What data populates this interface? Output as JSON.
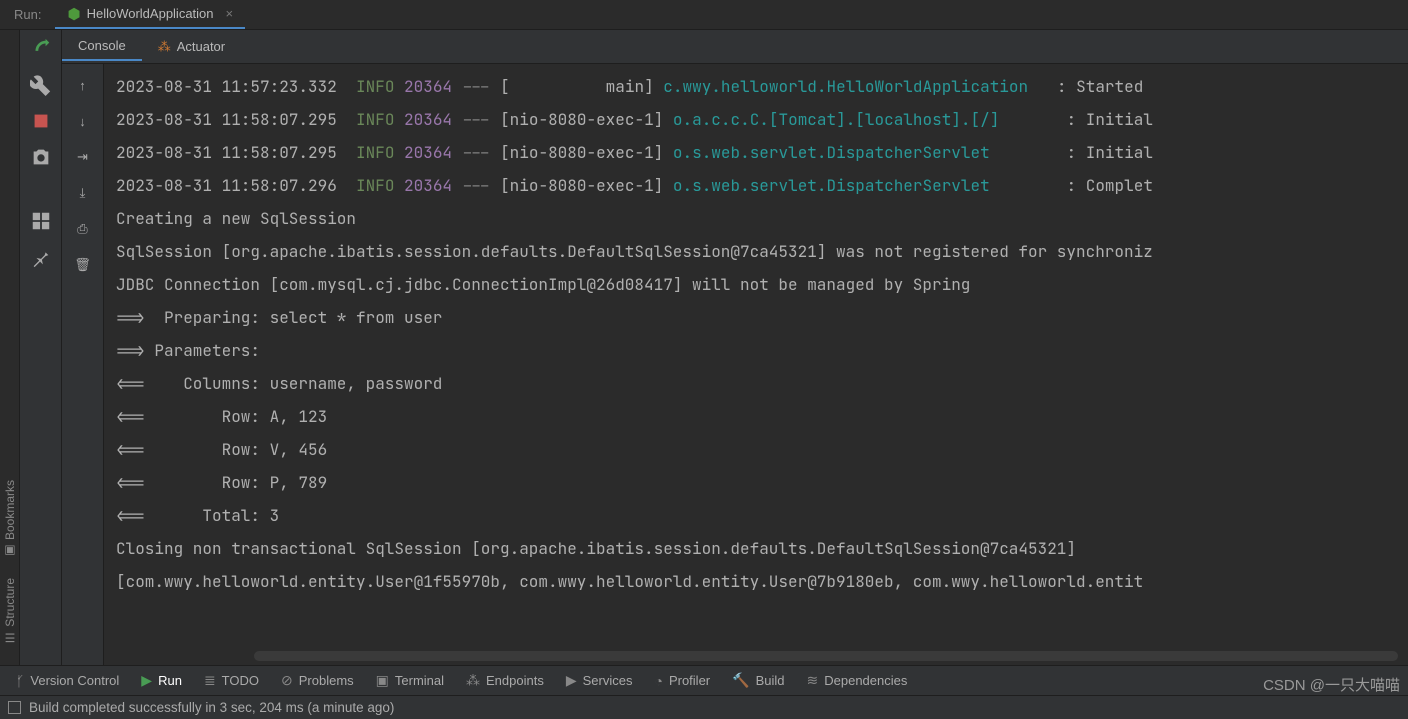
{
  "header": {
    "run_label": "Run:",
    "config_name": "HelloWorldApplication"
  },
  "panel_tabs": {
    "console": "Console",
    "actuator": "Actuator"
  },
  "log_lines": [
    {
      "ts": "2023-08-31 11:57:23.332",
      "lvl": "INFO",
      "pid": "20364",
      "thread": "[          main]",
      "class": "c.wwy.helloworld.HelloWorldApplication  ",
      "msg": ": Started"
    },
    {
      "ts": "2023-08-31 11:58:07.295",
      "lvl": "INFO",
      "pid": "20364",
      "thread": "[nio-8080-exec-1]",
      "class": "o.a.c.c.C.[Tomcat].[localhost].[/]      ",
      "msg": ": Initial"
    },
    {
      "ts": "2023-08-31 11:58:07.295",
      "lvl": "INFO",
      "pid": "20364",
      "thread": "[nio-8080-exec-1]",
      "class": "o.s.web.servlet.DispatcherServlet       ",
      "msg": ": Initial"
    },
    {
      "ts": "2023-08-31 11:58:07.296",
      "lvl": "INFO",
      "pid": "20364",
      "thread": "[nio-8080-exec-1]",
      "class": "o.s.web.servlet.DispatcherServlet       ",
      "msg": ": Complet"
    }
  ],
  "plain_lines": [
    "Creating a new SqlSession",
    "SqlSession [org.apache.ibatis.session.defaults.DefaultSqlSession@7ca45321] was not registered for synchroniz",
    "JDBC Connection [com.mysql.cj.jdbc.ConnectionImpl@26d08417] will not be managed by Spring",
    "==>  Preparing: select * from user",
    "==> Parameters: ",
    "<==    Columns: username, password",
    "<==        Row: A, 123",
    "<==        Row: V, 456",
    "<==        Row: P, 789",
    "<==      Total: 3",
    "Closing non transactional SqlSession [org.apache.ibatis.session.defaults.DefaultSqlSession@7ca45321]",
    "[com.wwy.helloworld.entity.User@1f55970b, com.wwy.helloworld.entity.User@7b9180eb, com.wwy.helloworld.entit"
  ],
  "side_panels": {
    "bookmarks": "Bookmarks",
    "structure": "Structure"
  },
  "bottom_tabs": {
    "vcs": "Version Control",
    "run": "Run",
    "todo": "TODO",
    "problems": "Problems",
    "terminal": "Terminal",
    "endpoints": "Endpoints",
    "services": "Services",
    "profiler": "Profiler",
    "build": "Build",
    "dependencies": "Dependencies"
  },
  "watermark": "CSDN @一只大喵喵",
  "status": "Build completed successfully in 3 sec, 204 ms (a minute ago)"
}
